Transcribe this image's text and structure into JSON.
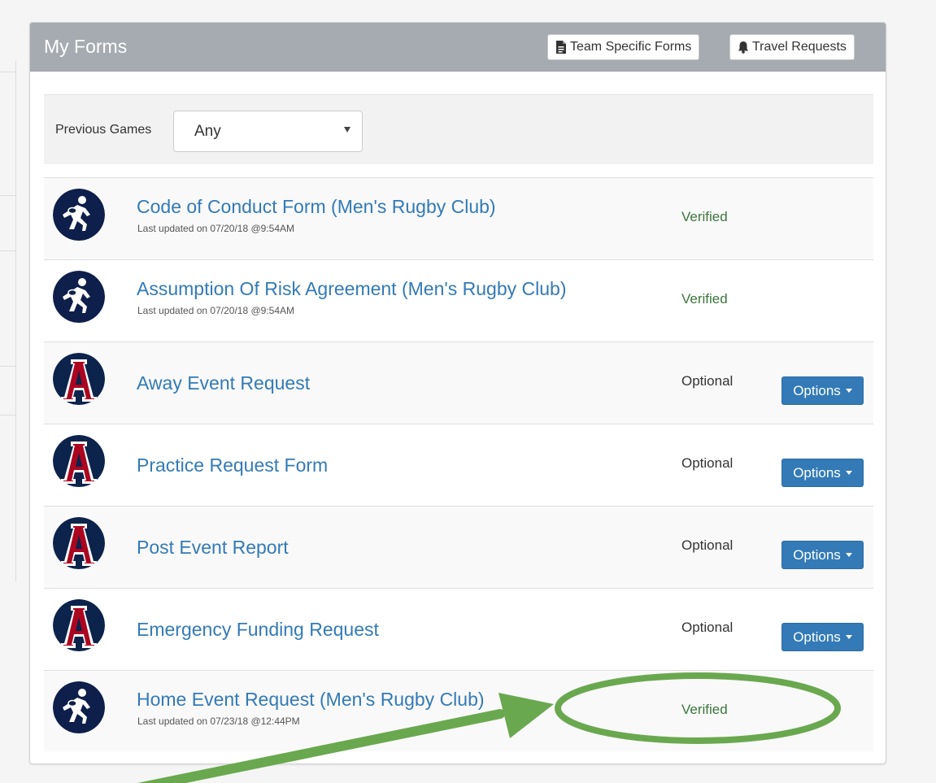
{
  "panel": {
    "title": "My Forms",
    "buttons": {
      "team_forms": "Team Specific Forms",
      "travel_requests": "Travel Requests"
    }
  },
  "filter": {
    "label": "Previous Games",
    "selected": "Any"
  },
  "forms": [
    {
      "title": "Code of Conduct Form",
      "team": " (Men's Rugby Club)",
      "updated": "Last updated on 07/20/18 @9:54AM",
      "status": "Verified",
      "logo": "rugby-club-icon"
    },
    {
      "title": "Assumption Of Risk Agreement",
      "team": " (Men's Rugby Club)",
      "updated": "Last updated on 07/20/18 @9:54AM",
      "status": "Verified",
      "logo": "rugby-club-icon"
    },
    {
      "title": "Away Event Request",
      "status": "Optional",
      "options": "Options",
      "logo": "university-a-logo"
    },
    {
      "title": "Practice Request Form",
      "status": "Optional",
      "options": "Options",
      "logo": "university-a-logo"
    },
    {
      "title": "Post Event Report",
      "status": "Optional",
      "options": "Options",
      "logo": "university-a-logo"
    },
    {
      "title": "Emergency Funding Request",
      "status": "Optional",
      "options": "Options",
      "logo": "university-a-logo"
    },
    {
      "title": "Home Event Request",
      "team": " (Men's Rugby Club)",
      "updated": "Last updated on 07/23/18 @12:44PM",
      "status": "Verified",
      "logo": "rugby-club-icon"
    }
  ],
  "colors": {
    "heading_bg": "#a6abb1",
    "link": "#337ab7",
    "verified": "#3c763d",
    "primary_button": "#337ab7",
    "annotation": "#6aa84f"
  }
}
